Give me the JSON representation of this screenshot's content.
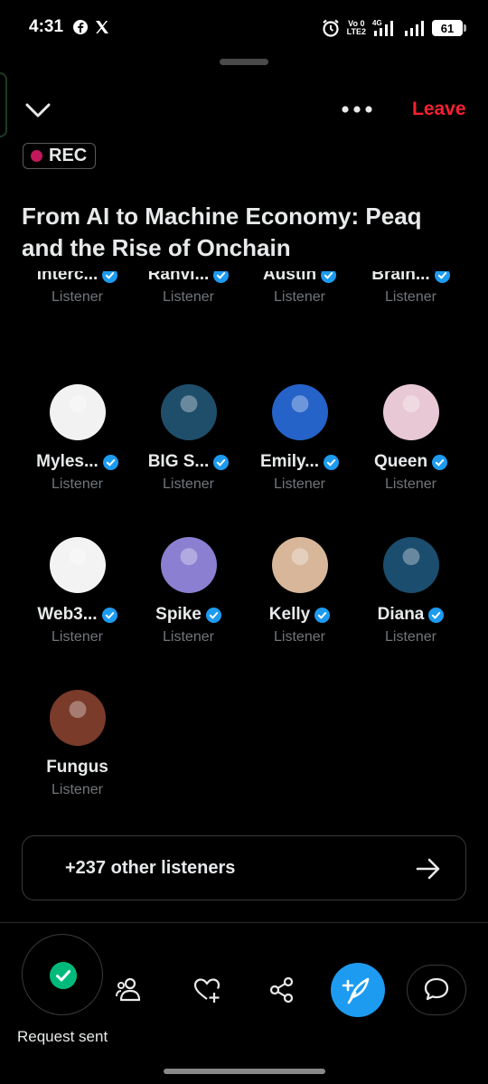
{
  "status_bar": {
    "time": "4:31",
    "volte_top": "Vo 0",
    "volte_bottom": "LTE2",
    "network": "4G",
    "battery": "61"
  },
  "header": {
    "leave_label": "Leave",
    "rec_label": "REC",
    "title": "From AI to Machine Economy: Peaq and the Rise of Onchain"
  },
  "listeners": [
    {
      "name": "Interc...",
      "role": "Listener",
      "avatar_color": "#c0392b"
    },
    {
      "name": "Ranvi...",
      "role": "Listener",
      "avatar_color": "#333333"
    },
    {
      "name": "Austin",
      "role": "Listener",
      "avatar_color": "#d4a017"
    },
    {
      "name": "Brain...",
      "role": "Listener",
      "avatar_color": "#2e7d32"
    },
    {
      "name": "Myles...",
      "role": "Listener",
      "avatar_color": "#f2f2f2"
    },
    {
      "name": "BIG S...",
      "role": "Listener",
      "avatar_color": "#1f4e6b"
    },
    {
      "name": "Emily...",
      "role": "Listener",
      "avatar_color": "#2563c9"
    },
    {
      "name": "Queen",
      "role": "Listener",
      "avatar_color": "#e8c8d4"
    },
    {
      "name": "Web3...",
      "role": "Listener",
      "avatar_color": "#f3f3f3"
    },
    {
      "name": "Spike",
      "role": "Listener",
      "avatar_color": "#8a7fd1"
    },
    {
      "name": "Kelly",
      "role": "Listener",
      "avatar_color": "#d7b69a"
    },
    {
      "name": "Diana",
      "role": "Listener",
      "avatar_color": "#1b4d6e"
    },
    {
      "name": "Fungus",
      "role": "Listener",
      "avatar_color": "#7a3b2a"
    }
  ],
  "more_listeners": {
    "label": "+237 other listeners"
  },
  "toolbar": {
    "request_status": "Request sent",
    "icons": [
      "check-icon",
      "people-icon",
      "heart-plus-icon",
      "share-icon",
      "compose-icon",
      "chat-bubble-icon"
    ]
  },
  "colors": {
    "accent": "#1d9bf0",
    "leave": "#f4212e",
    "rec_dot": "#c1185b",
    "verified": "#1d9bf0",
    "success": "#00ba7c"
  }
}
